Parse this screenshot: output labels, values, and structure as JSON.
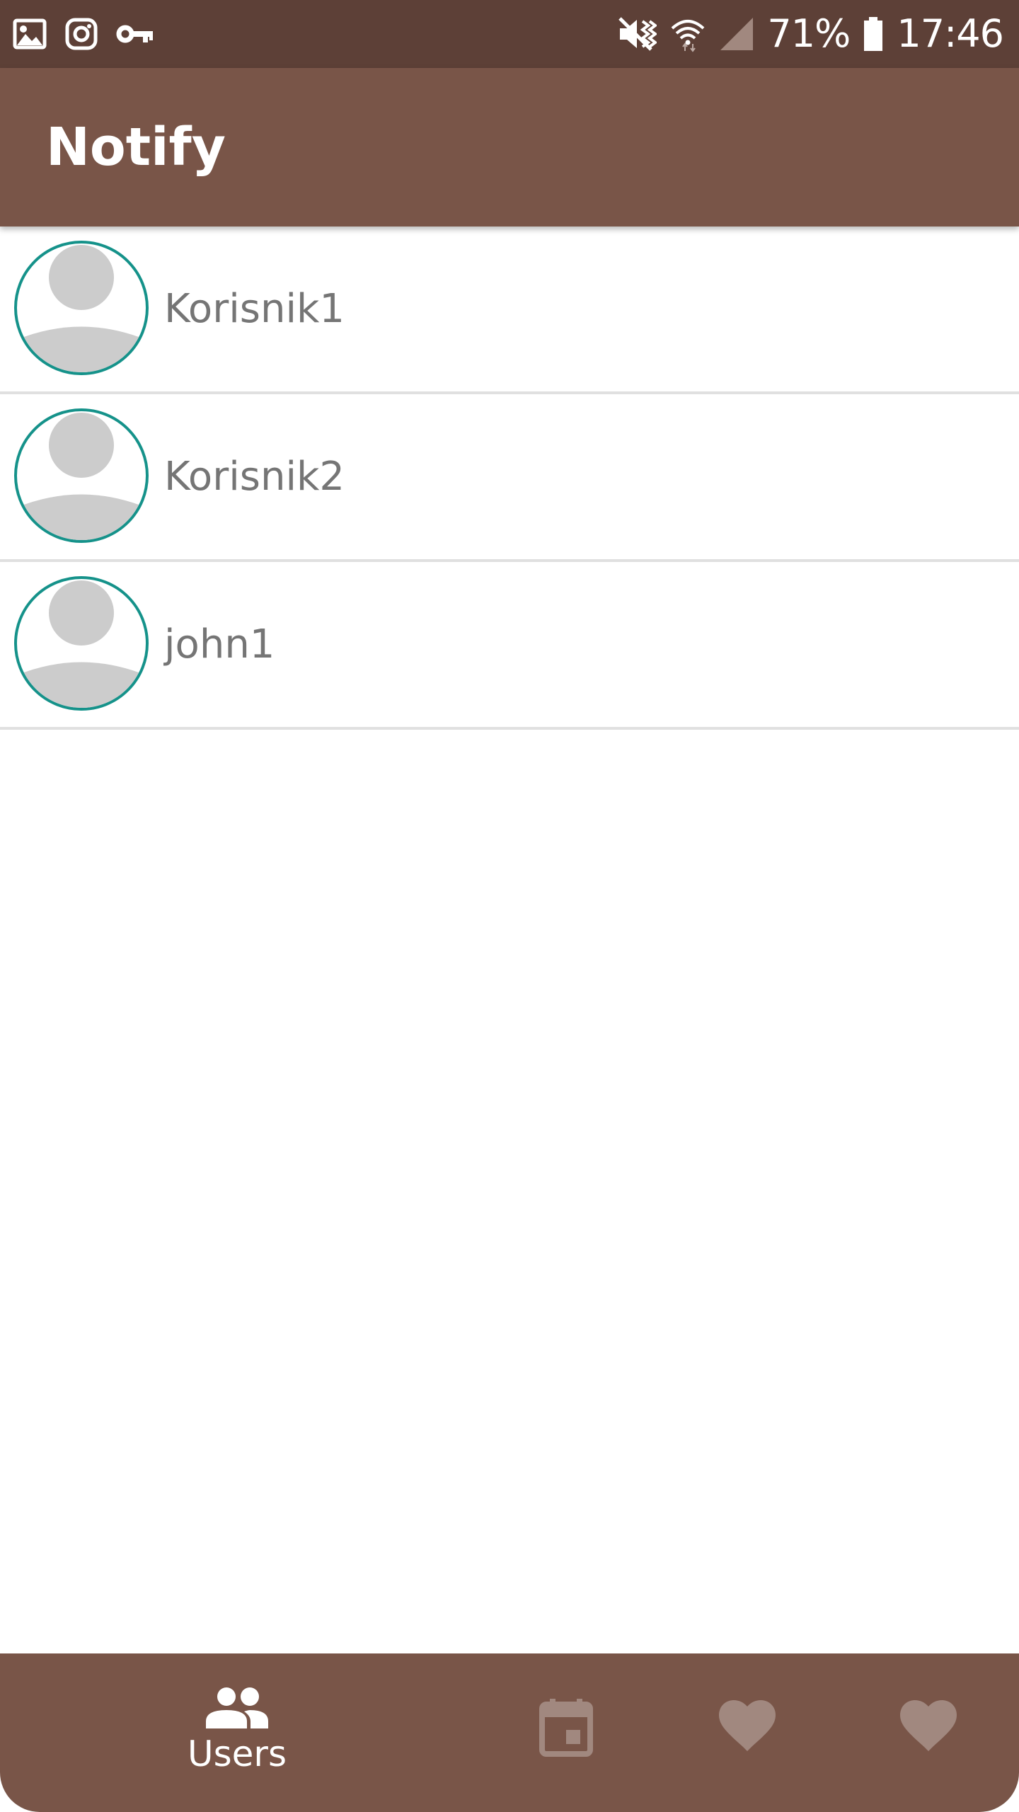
{
  "status_bar": {
    "left_icons": [
      "image-icon",
      "instagram-icon",
      "vpn-key-icon"
    ],
    "right_icons": [
      "vibrate-mute-icon",
      "wifi-icon",
      "signal-icon",
      "battery-icon"
    ],
    "battery_percent": "71%",
    "time": "17:46"
  },
  "app_bar": {
    "title": "Notify"
  },
  "users": [
    {
      "name": "Korisnik1"
    },
    {
      "name": "Korisnik2"
    },
    {
      "name": "john1"
    }
  ],
  "bottom_nav": {
    "items": [
      {
        "label": "Users",
        "icon": "people-icon",
        "selected": true
      },
      {
        "label": "",
        "icon": "calendar-icon",
        "selected": false
      },
      {
        "label": "",
        "icon": "heart-icon",
        "selected": false
      },
      {
        "label": "",
        "icon": "heart-icon",
        "selected": false
      }
    ]
  },
  "colors": {
    "status_bar": "#5d4037",
    "primary": "#795548",
    "avatar_border": "#15928a",
    "avatar_silhouette": "#cccccc",
    "divider": "#e0e0e0",
    "name_text": "#757575",
    "nav_inactive_icon": "#a1887f"
  }
}
